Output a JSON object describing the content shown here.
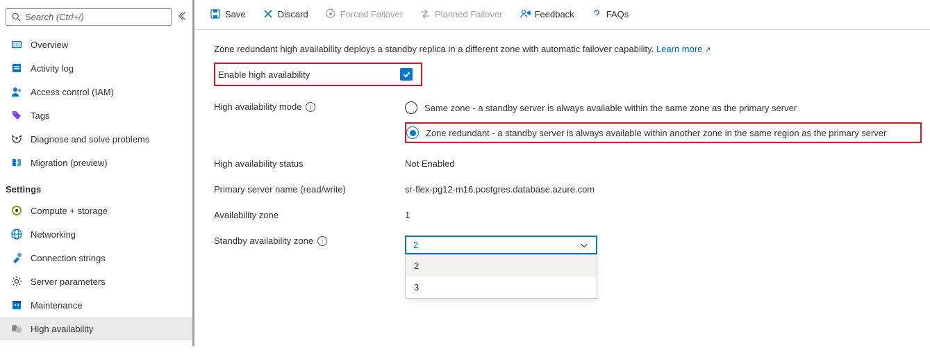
{
  "search": {
    "placeholder": "Search (Ctrl+/)"
  },
  "sidebar": {
    "items": [
      {
        "label": "Overview"
      },
      {
        "label": "Activity log"
      },
      {
        "label": "Access control (IAM)"
      },
      {
        "label": "Tags"
      },
      {
        "label": "Diagnose and solve problems"
      },
      {
        "label": "Migration (preview)"
      }
    ],
    "settings_header": "Settings",
    "settings_items": [
      {
        "label": "Compute + storage"
      },
      {
        "label": "Networking"
      },
      {
        "label": "Connection strings"
      },
      {
        "label": "Server parameters"
      },
      {
        "label": "Maintenance"
      },
      {
        "label": "High availability"
      }
    ]
  },
  "toolbar": {
    "save": "Save",
    "discard": "Discard",
    "forced_failover": "Forced Failover",
    "planned_failover": "Planned Failover",
    "feedback": "Feedback",
    "faqs": "FAQs"
  },
  "content": {
    "description": "Zone redundant high availability deploys a standby replica in a different zone with automatic failover capability.",
    "learn_more": "Learn more",
    "enable_ha_label": "Enable high availability",
    "ha_mode_label": "High availability mode",
    "ha_mode_options": {
      "same_zone": "Same zone - a standby server is always available within the same zone as the primary server",
      "zone_redundant": "Zone redundant - a standby server is always available within another zone in the same region as the primary server"
    },
    "ha_status_label": "High availability status",
    "ha_status_value": "Not Enabled",
    "primary_name_label": "Primary server name (read/write)",
    "primary_name_value": "sr-flex-pg12-m16.postgres.database.azure.com",
    "az_label": "Availability zone",
    "az_value": "1",
    "standby_az_label": "Standby availability zone",
    "standby_az_selected": "2",
    "standby_az_options": [
      "2",
      "3"
    ]
  }
}
